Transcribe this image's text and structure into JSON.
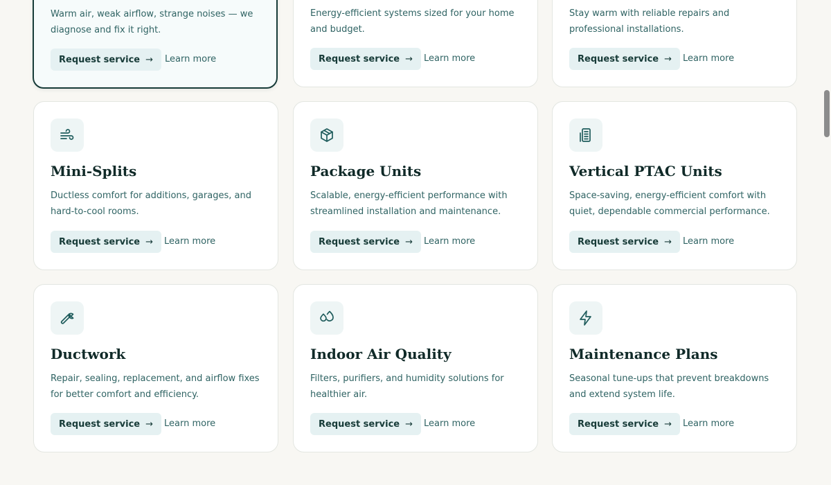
{
  "row1": [
    {
      "desc": "Warm air, weak airflow, strange noises — we diagnose and fix it right.",
      "request_label": "Request service",
      "learn_label": "Learn more"
    },
    {
      "desc": "Energy-efficient systems sized for your home and budget.",
      "request_label": "Request service",
      "learn_label": "Learn more"
    },
    {
      "desc": "Stay warm with reliable repairs and professional installations.",
      "request_label": "Request service",
      "learn_label": "Learn more"
    }
  ],
  "row2": [
    {
      "icon": "wind-icon",
      "title": "Mini-Splits",
      "desc": "Ductless comfort for additions, garages, and hard-to-cool rooms.",
      "request_label": "Request service",
      "learn_label": "Learn more"
    },
    {
      "icon": "package-icon",
      "title": "Package Units",
      "desc": "Scalable, energy-efficient performance with streamlined installation and maintenance.",
      "request_label": "Request service",
      "learn_label": "Learn more"
    },
    {
      "icon": "building-unit-icon",
      "title": "Vertical PTAC Units",
      "desc": "Space-saving, energy-efficient comfort with quiet, dependable commercial performance.",
      "request_label": "Request service",
      "learn_label": "Learn more"
    }
  ],
  "row3": [
    {
      "icon": "wrench-icon",
      "title": "Ductwork",
      "desc": "Repair, sealing, replacement, and airflow fixes for better comfort and efficiency.",
      "request_label": "Request service",
      "learn_label": "Learn more"
    },
    {
      "icon": "droplets-icon",
      "title": "Indoor Air Quality",
      "desc": "Filters, purifiers, and humidity solutions for healthier air.",
      "request_label": "Request service",
      "learn_label": "Learn more"
    },
    {
      "icon": "lightning-icon",
      "title": "Maintenance Plans",
      "desc": "Seasonal tune-ups that prevent breakdowns and extend system life.",
      "request_label": "Request service",
      "learn_label": "Learn more"
    }
  ],
  "arrow_glyph": "→",
  "colors": {
    "accent": "#173b38",
    "button_bg": "#e5f1f2",
    "icon_tile_bg": "#eef5f5",
    "page_bg": "#f8f7f3",
    "icon_stroke": "#1f5c5c"
  }
}
